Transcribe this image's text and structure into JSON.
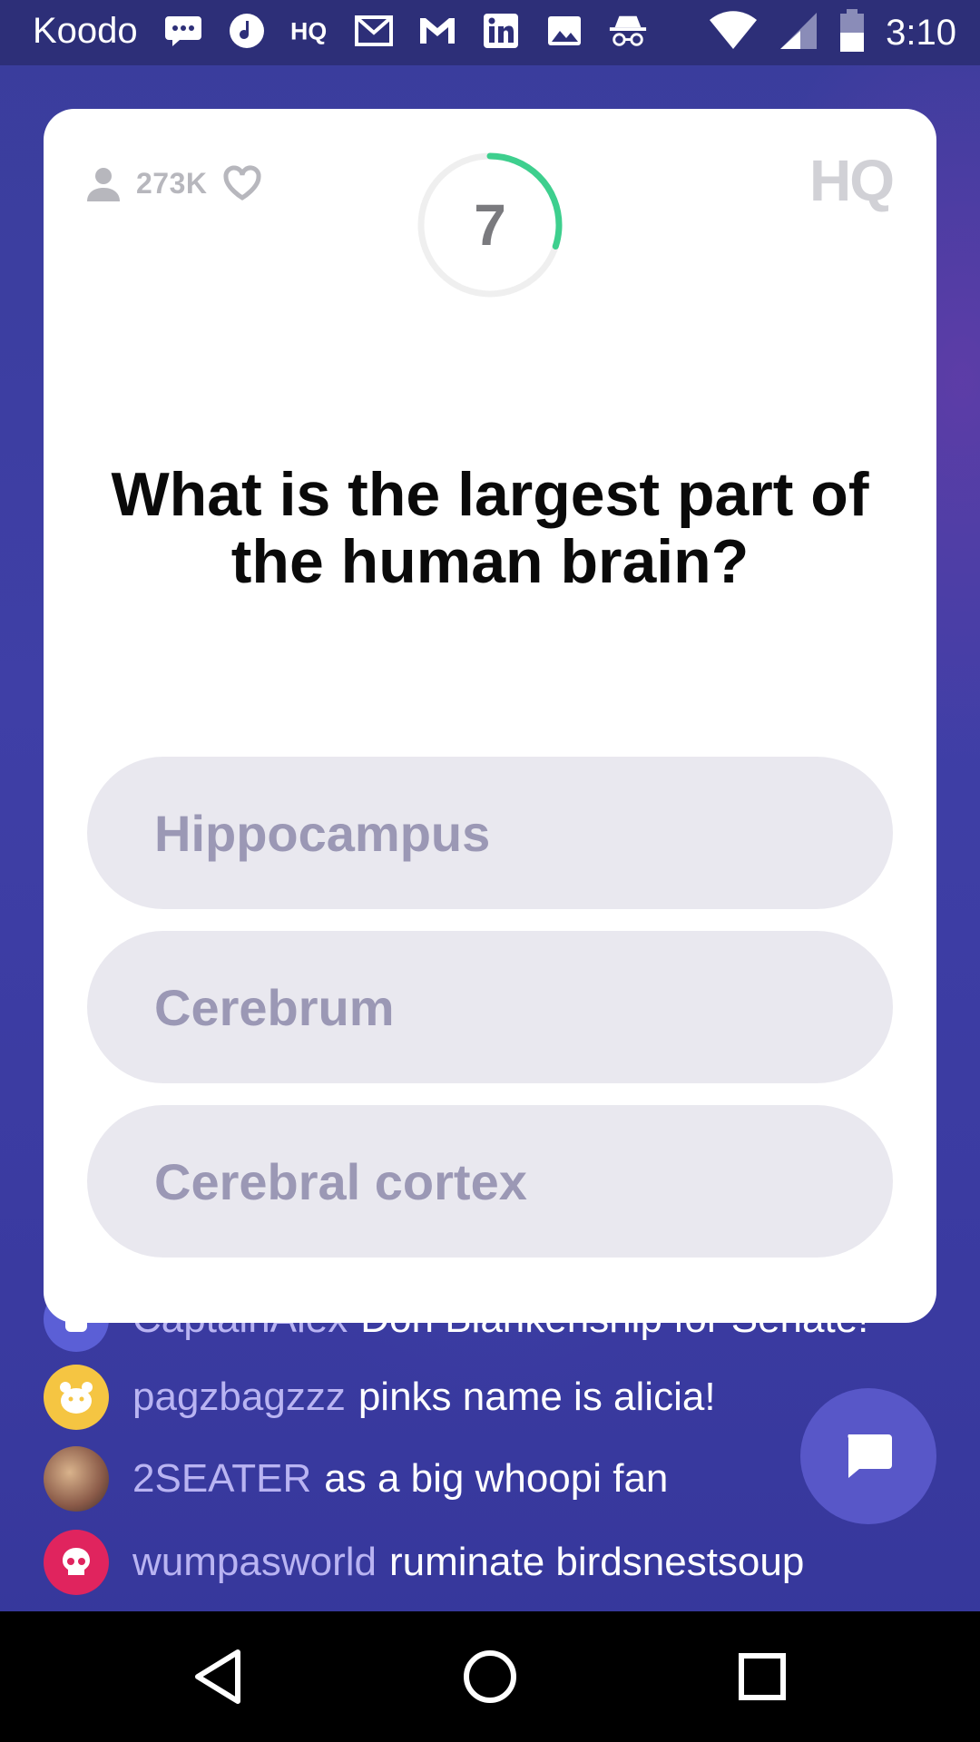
{
  "status_bar": {
    "carrier": "Koodo",
    "time": "3:10",
    "icons": [
      "messenger-icon",
      "music-note-icon",
      "hq-app-icon",
      "gmail-icon",
      "gmail-icon",
      "linkedin-icon",
      "gallery-icon",
      "incognito-icon",
      "wifi-icon",
      "cellular-signal-icon",
      "battery-icon"
    ]
  },
  "game": {
    "viewer_count": "273K",
    "timer_value": "7",
    "timer_progress": 0.3,
    "logo": "HQ",
    "question": "What is the largest part of the human brain?",
    "answers": [
      "Hippocampus",
      "Cerebrum",
      "Cerebral cortex"
    ]
  },
  "chat": {
    "messages": [
      {
        "user": "CaptainAlex",
        "text": "Don Blankenship for Senate!",
        "avatar_color": "#5b5fd6"
      },
      {
        "user": "pagzbagzzz",
        "text": "pinks name is alicia!",
        "avatar_color": "#f5c542"
      },
      {
        "user": "2SEATER",
        "text": "as a big whoopi fan",
        "avatar_color": "#8a5a48"
      },
      {
        "user": "wumpasworld",
        "text": "ruminate birdsnestsoup",
        "avatar_color": "#e0245e"
      }
    ]
  },
  "colors": {
    "background": "#3b3f9e",
    "timer_accent": "#3ecf8e",
    "answer_bg": "#e9e8ef",
    "answer_text": "#9b98b5",
    "chat_username": "#b9b4f2"
  }
}
